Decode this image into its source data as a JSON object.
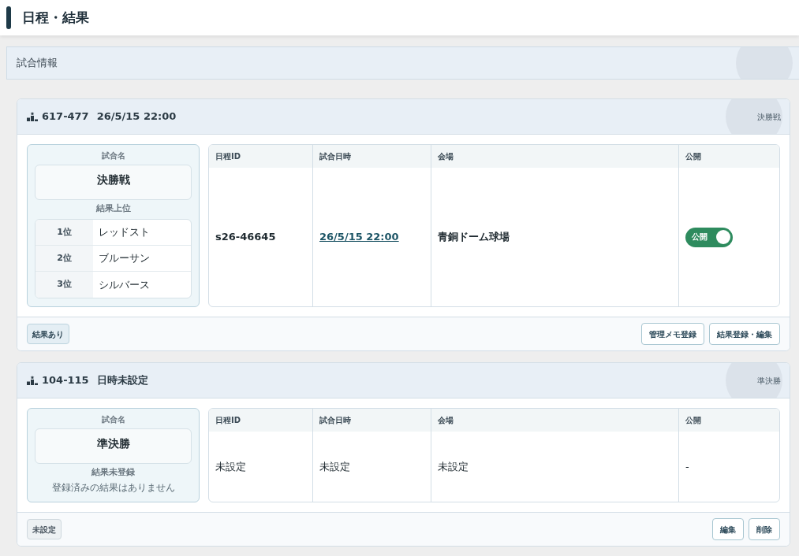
{
  "page_title": "日程・結果",
  "section_title": "試合情報",
  "matches": [
    {
      "code": "617-477",
      "datetime": "26/5/15 22:00",
      "round": "決勝戦",
      "name_label": "試合名",
      "name": "決勝戦",
      "results_label": "結果上位",
      "results": [
        {
          "rank": "1位",
          "team": "レッドスト"
        },
        {
          "rank": "2位",
          "team": "ブルーサン"
        },
        {
          "rank": "3位",
          "team": "シルバース"
        }
      ],
      "columns": [
        "日程ID",
        "試合日時",
        "会場",
        "公開"
      ],
      "cells": [
        {
          "kind": "text",
          "text": "s26-46645"
        },
        {
          "kind": "link",
          "text": "26/5/15 22:00"
        },
        {
          "kind": "text",
          "text": "青銅ドーム球場"
        },
        {
          "kind": "toggle",
          "label": "公開",
          "on": true
        }
      ],
      "status": {
        "text": "結果あり",
        "kind": "done"
      },
      "actions": [
        "管理メモ登録",
        "結果登録・編集"
      ]
    },
    {
      "code": "104-115",
      "datetime": "日時未設定",
      "round": "準決勝",
      "name_label": "試合名",
      "name": "準決勝",
      "results_label": "結果未登録",
      "empty_message": "登録済みの結果はありません",
      "columns": [
        "日程ID",
        "試合日時",
        "会場",
        "公開"
      ],
      "cells": [
        {
          "kind": "unset",
          "text": "未設定"
        },
        {
          "kind": "unset",
          "text": "未設定"
        },
        {
          "kind": "unset",
          "text": "未設定"
        },
        {
          "kind": "unset",
          "text": "-"
        }
      ],
      "status": {
        "text": "未設定",
        "kind": "pending"
      },
      "actions": [
        "編集",
        "削除"
      ]
    }
  ]
}
